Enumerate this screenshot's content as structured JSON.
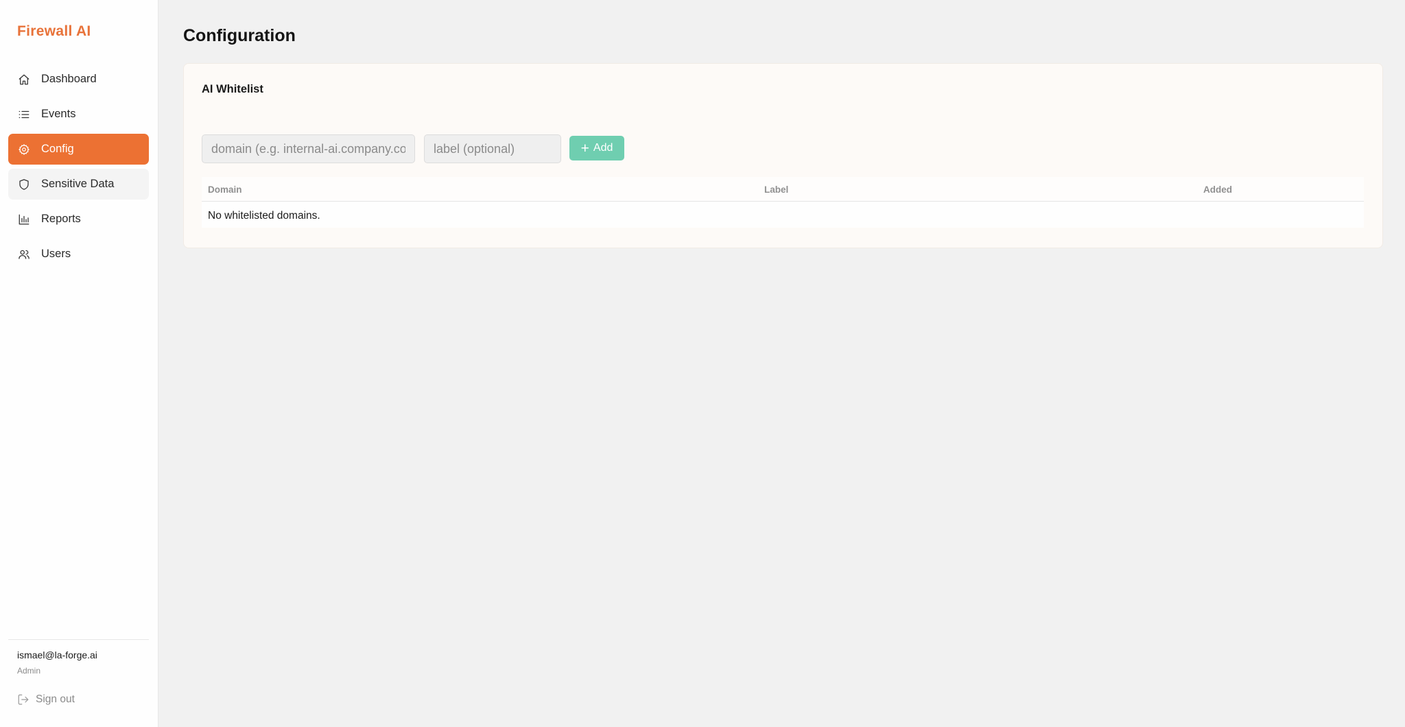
{
  "app": {
    "brand": "Firewall AI"
  },
  "sidebar": {
    "items": [
      {
        "label": "Dashboard",
        "icon": "home-icon"
      },
      {
        "label": "Events",
        "icon": "list-icon"
      },
      {
        "label": "Config",
        "icon": "gear-icon",
        "active": true
      },
      {
        "label": "Sensitive Data",
        "icon": "shield-icon"
      },
      {
        "label": "Reports",
        "icon": "bar-chart-icon"
      },
      {
        "label": "Users",
        "icon": "users-icon"
      }
    ],
    "user": {
      "email": "ismael@la-forge.ai",
      "role": "Admin"
    },
    "signout_label": "Sign out"
  },
  "main": {
    "title": "Configuration",
    "whitelist": {
      "title": "AI Whitelist",
      "domain_placeholder": "domain (e.g. internal-ai.company.com)",
      "label_placeholder": "label (optional)",
      "add_label": "Add",
      "columns": [
        "Domain",
        "Label",
        "Added"
      ],
      "empty_text": "No whitelisted domains."
    }
  },
  "colors": {
    "brand": "#e8733a",
    "active_nav": "#ec7133",
    "add_button": "#6fceb0"
  }
}
